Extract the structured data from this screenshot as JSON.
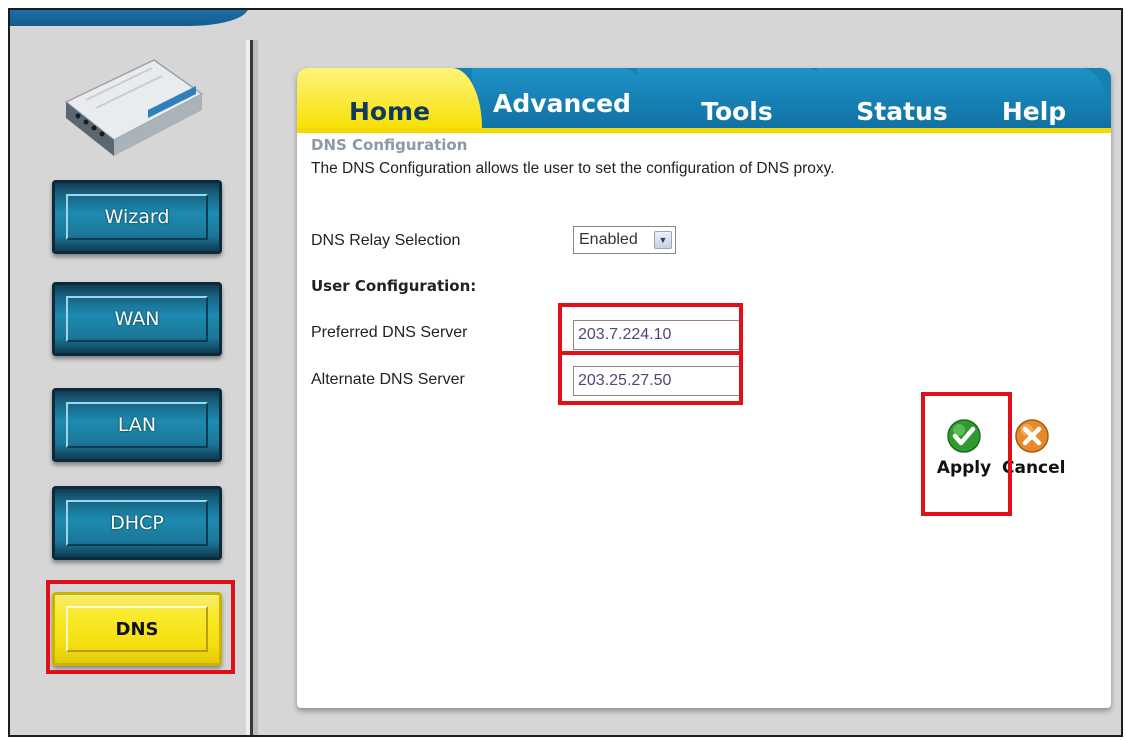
{
  "sidebar": {
    "items": [
      {
        "label": "Wizard"
      },
      {
        "label": "WAN"
      },
      {
        "label": "LAN"
      },
      {
        "label": "DHCP"
      },
      {
        "label": "DNS",
        "active": true
      }
    ]
  },
  "tabs": [
    {
      "label": "Home",
      "active": true
    },
    {
      "label": "Advanced"
    },
    {
      "label": "Tools"
    },
    {
      "label": "Status"
    },
    {
      "label": "Help"
    }
  ],
  "main": {
    "section_title": "DNS Configuration",
    "description": "The DNS Configuration allows tle user to set the configuration of DNS proxy.",
    "relay_label": "DNS Relay Selection",
    "relay_value": "Enabled",
    "user_config_label": "User Configuration:",
    "preferred_label": "Preferred DNS Server",
    "preferred_value": "203.7.224.10",
    "alternate_label": "Alternate DNS Server",
    "alternate_value": "203.25.27.50"
  },
  "actions": {
    "apply_label": "Apply",
    "cancel_label": "Cancel"
  },
  "colors": {
    "highlight": "#e0101a",
    "tab_blue": "#1680b3",
    "tab_yellow": "#f7df00"
  }
}
